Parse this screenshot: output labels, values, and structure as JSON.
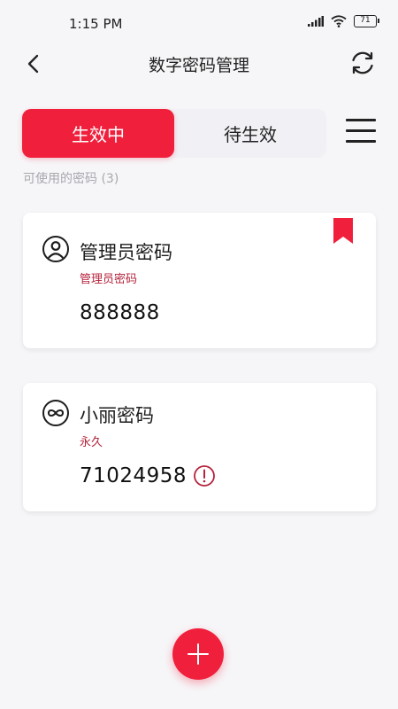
{
  "status_bar": {
    "time": "1:15 PM",
    "battery": "71",
    "icons": [
      "signal-icon",
      "wifi-icon",
      "battery-icon"
    ]
  },
  "header": {
    "title": "数字密码管理",
    "back_icon": "chevron-left-icon",
    "refresh_icon": "refresh-icon"
  },
  "tabs": [
    {
      "label": "生效中",
      "active": true
    },
    {
      "label": "待生效",
      "active": false
    }
  ],
  "menu_icon": "hamburger-menu-icon",
  "section_label": "可使用的密码 (3)",
  "passwords": [
    {
      "name": "管理员密码",
      "type": "管理员密码",
      "code": "888888",
      "icon": "user-icon",
      "bookmarked": true
    },
    {
      "name": "小丽密码",
      "type": "永久",
      "code": "71024958",
      "icon": "infinity-icon",
      "warning": true
    }
  ],
  "fab_icon": "plus-icon",
  "colors": {
    "accent": "#f0203d",
    "subtitle": "#b5233c",
    "background": "#f6f6f8",
    "tab_background": "#f1f1f5"
  }
}
